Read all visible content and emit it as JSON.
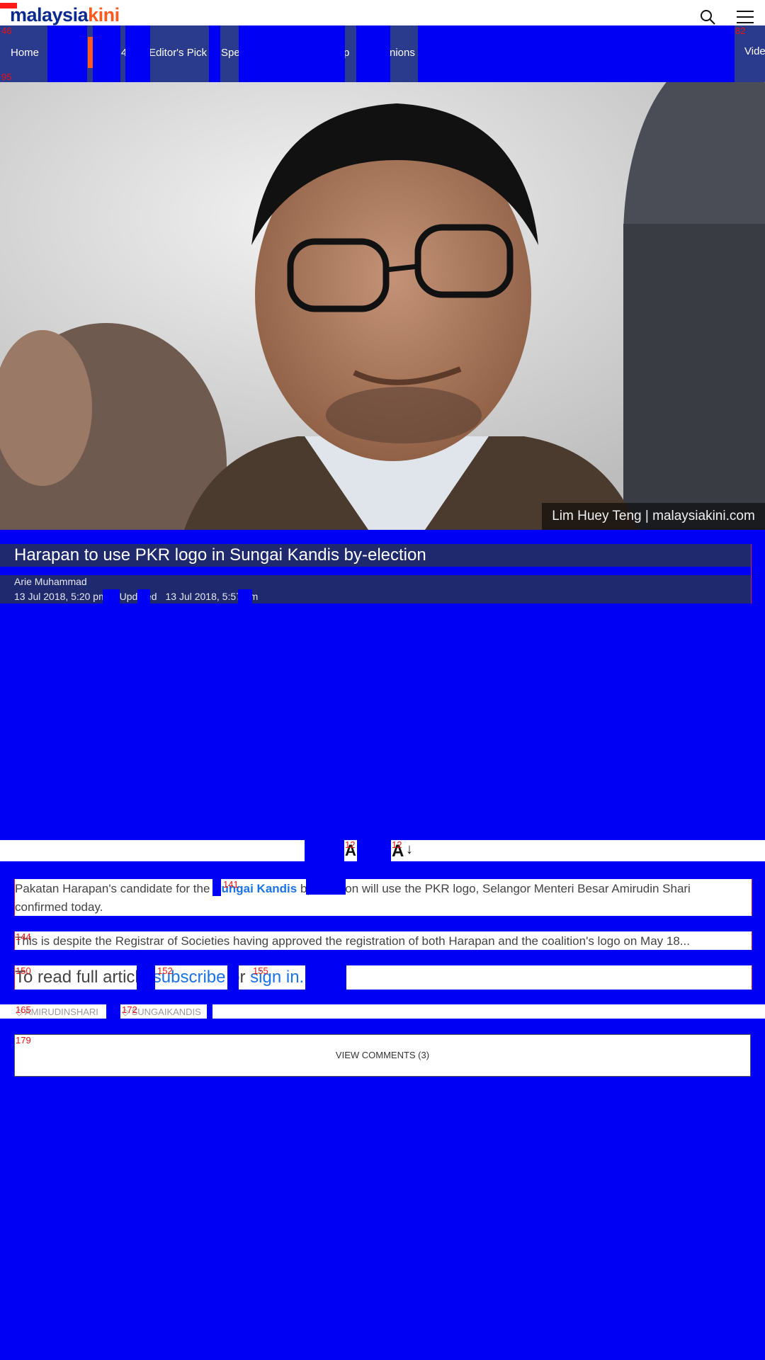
{
  "brand": {
    "logo_part1": "malaysia",
    "logo_part2": "kini"
  },
  "nav": {
    "items": [
      "Home",
      "4",
      "Editor's Pick",
      "Spec",
      "p",
      "nions",
      "Vide"
    ]
  },
  "photo": {
    "credit": "Lim Huey Teng | malaysiakini.com"
  },
  "article": {
    "title": "Harapan to use PKR logo in Sungai Kandis by-election",
    "author": "Arie Muhammad",
    "published": "13 Jul 2018, 5:20 pm",
    "updated_label": "Updated",
    "updated": "13 Jul 2018, 5:57 pm",
    "para1_a": "Pakatan Harapan's candidate for the ",
    "para1_link": "Sungai Kandis",
    "para1_b": " by-election will use the PKR logo, Selangor Menteri Besar Amirudin Shari",
    "para1_c": "confirmed today.",
    "para2": "This is despite the Registrar of Societies having approved the registration of both Harapan and the coalition's logo on May 18...",
    "cta_a": "To read full article",
    "cta_subscribe": "subscribe",
    "cta_or": "or",
    "cta_signin": "sign in."
  },
  "font_controls": {
    "small": "A",
    "large": "A",
    "arrow": "↓"
  },
  "tags": [
    "AMIRUDINSHARI",
    "SUNGAIKANDIS"
  ],
  "comments": {
    "label": "VIEW COMMENTS (3)"
  },
  "overlay_numbers": [
    "46",
    "82",
    "95",
    "12",
    "12",
    "141",
    "144",
    "150",
    "152",
    "155",
    "165",
    "172",
    "179"
  ],
  "colors": {
    "brand_blue": "#0b2a8f",
    "brand_orange": "#ff5a1f",
    "nav_bg": "#2a3a8c",
    "mask": "#0000f5"
  }
}
